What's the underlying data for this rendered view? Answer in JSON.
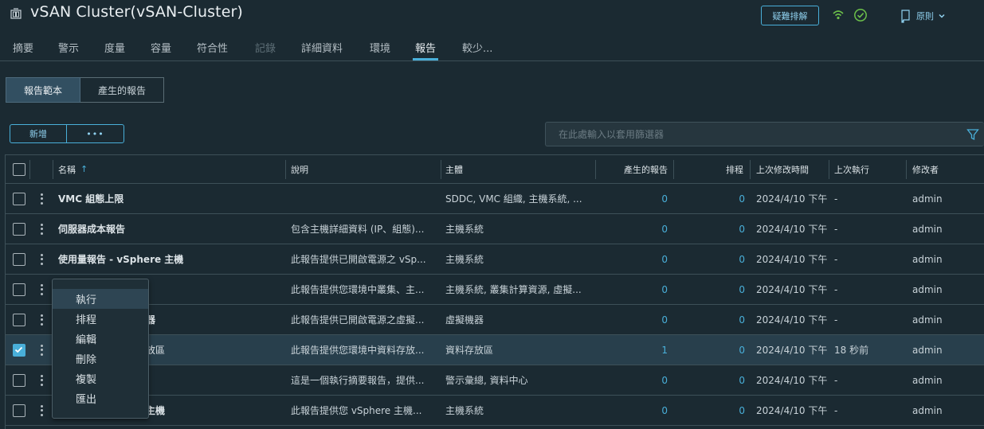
{
  "header": {
    "title": "vSAN Cluster(vSAN-Cluster)",
    "troubleshoot_label": "疑難排解",
    "policy_label": "原則",
    "icons": [
      "cluster-icon",
      "network-icon",
      "check-circle-icon",
      "policy-icon",
      "chevron-down-icon"
    ]
  },
  "tabs": [
    {
      "label": "摘要",
      "state": "normal"
    },
    {
      "label": "警示",
      "state": "normal"
    },
    {
      "label": "度量",
      "state": "normal"
    },
    {
      "label": "容量",
      "state": "normal"
    },
    {
      "label": "符合性",
      "state": "normal"
    },
    {
      "label": "記錄",
      "state": "disabled"
    },
    {
      "label": "詳細資料",
      "state": "normal"
    },
    {
      "label": "環境",
      "state": "normal"
    },
    {
      "label": "報告",
      "state": "active"
    },
    {
      "label": "較少...",
      "state": "normal"
    }
  ],
  "segments": {
    "templates": "報告範本",
    "generated": "產生的報告"
  },
  "toolbar": {
    "add_label": "新增",
    "more_label": "•••"
  },
  "filter": {
    "placeholder": "在此處輸入以套用篩選器",
    "value": ""
  },
  "table": {
    "columns": {
      "name": "名稱",
      "description": "說明",
      "subject": "主體",
      "generated": "產生的報告",
      "schedule": "排程",
      "last_modified": "上次修改時間",
      "last_run": "上次執行",
      "modified_by": "修改者"
    },
    "sort_indicator": "↑",
    "rows": [
      {
        "name": "VMC 組態上限",
        "description": "",
        "subject": "SDDC, VMC 組織, 主機系統, ...",
        "generated": "0",
        "schedule": "0",
        "last_modified": "2024/4/10 下午",
        "last_run": "-",
        "modified_by": "admin",
        "checked": false
      },
      {
        "name": "伺服器成本報告",
        "description": "包含主機詳細資料 (IP、組態)...",
        "subject": "主機系統",
        "generated": "0",
        "schedule": "0",
        "last_modified": "2024/4/10 下午",
        "last_run": "-",
        "modified_by": "admin",
        "checked": false
      },
      {
        "name": "使用量報告 - vSphere 主機",
        "description": "此報告提供已開啟電源之 vSp...",
        "subject": "主機系統",
        "generated": "0",
        "schedule": "0",
        "last_modified": "2024/4/10 下午",
        "last_run": "-",
        "modified_by": "admin",
        "checked": false
      },
      {
        "name": "",
        "description": "此報告提供您環境中叢集、主...",
        "subject": "主機系統, 叢集計算資源, 虛擬...",
        "generated": "0",
        "schedule": "0",
        "last_modified": "2024/4/10 下午",
        "last_run": "-",
        "modified_by": "admin",
        "checked": false
      },
      {
        "name": "器",
        "description": "此報告提供已開啟電源之虛擬...",
        "subject": "虛擬機器",
        "generated": "0",
        "schedule": "0",
        "last_modified": "2024/4/10 下午",
        "last_run": "-",
        "modified_by": "admin",
        "checked": false
      },
      {
        "name": "放區",
        "description": "此報告提供您環境中資料存放...",
        "subject": "資料存放區",
        "generated": "1",
        "schedule": "0",
        "last_modified": "2024/4/10 下午",
        "last_run": "18 秒前",
        "modified_by": "admin",
        "checked": true
      },
      {
        "name": "",
        "description": "這是一個執行摘要報告，提供...",
        "subject": "警示彙總, 資料中心",
        "generated": "0",
        "schedule": "0",
        "last_modified": "2024/4/10 下午",
        "last_run": "-",
        "modified_by": "admin",
        "checked": false
      },
      {
        "name": "主機",
        "description": "此報告提供您 vSphere 主機...",
        "subject": "主機系統",
        "generated": "0",
        "schedule": "0",
        "last_modified": "2024/4/10 下午",
        "last_run": "-",
        "modified_by": "admin",
        "checked": false
      }
    ]
  },
  "context_menu": {
    "items": [
      "執行",
      "排程",
      "編輯",
      "刪除",
      "複製",
      "匯出"
    ],
    "highlighted": "執行"
  },
  "colors": {
    "accent": "#49afd9",
    "background": "#1b2a32",
    "selected_row": "#283f4c"
  }
}
